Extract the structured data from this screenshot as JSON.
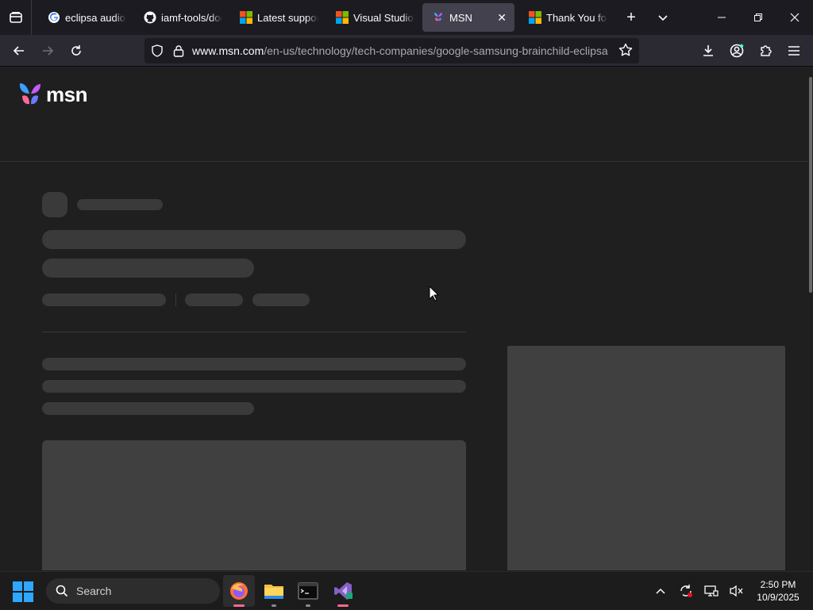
{
  "browser": {
    "tabs": [
      {
        "title": "eclipsa audio g",
        "favicon": "google-icon",
        "active": false
      },
      {
        "title": "iamf-tools/doc",
        "favicon": "github-icon",
        "active": false
      },
      {
        "title": "Latest support",
        "favicon": "microsoft-icon",
        "active": false
      },
      {
        "title": "Visual Studio C",
        "favicon": "microsoft-icon",
        "active": false
      },
      {
        "title": "MSN",
        "favicon": "msn-icon",
        "active": true
      },
      {
        "title": "Thank You for",
        "favicon": "microsoft-icon",
        "active": false
      }
    ],
    "url_host": "www.msn.com",
    "url_path": "/en-us/technology/tech-companies/google-samsung-brainchild-eclipsa"
  },
  "page": {
    "logo_text": "msn",
    "state": "loading-skeleton"
  },
  "taskbar": {
    "search_placeholder": "Search",
    "apps": [
      "firefox-icon",
      "file-explorer-icon",
      "terminal-icon",
      "visual-studio-icon"
    ],
    "time": "2:50 PM",
    "date": "10/9/2025"
  },
  "colors": {
    "tab_bg": "#1c1b22",
    "toolbar_bg": "#2b2a33",
    "page_bg": "#1f1f1f",
    "skeleton": "#3a3a3a"
  }
}
